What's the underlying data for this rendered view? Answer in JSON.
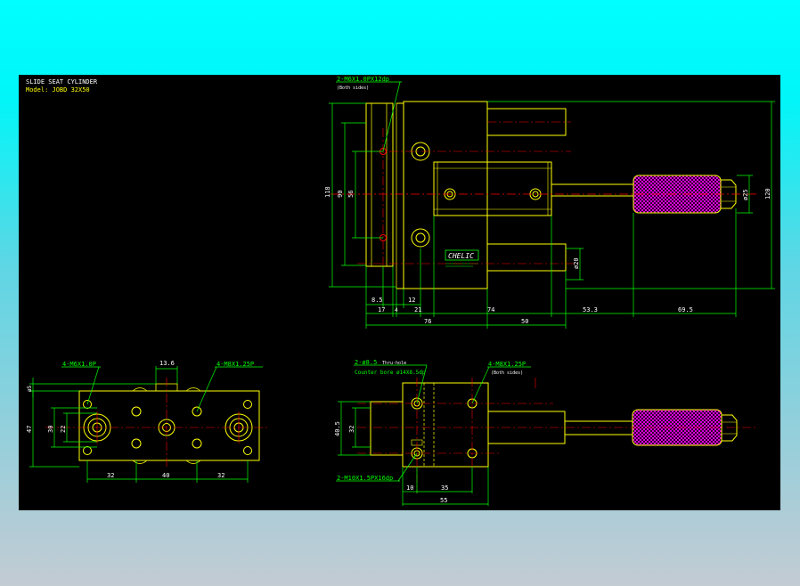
{
  "title_block": {
    "title": "SLIDE SEAT CYLINDER",
    "model": "Model: JOBD 32X50"
  },
  "brand": "CHELIC",
  "side_view": {
    "callout_port": "2-M6X1.0PX12dp",
    "callout_port_sub": "(Both sides)",
    "dims": {
      "height_118": "118",
      "height_90": "90",
      "height_56": "56",
      "dia_20": "ø20",
      "dia_25": "ø25",
      "height_120": "120",
      "d_8_5": "8.5",
      "d_12": "12",
      "d_17": "17",
      "d_4": "4",
      "d_21": "21",
      "d_74": "74",
      "d_53_3": "53.3",
      "d_69_5": "69.5",
      "d_76": "76",
      "d_50": "50"
    }
  },
  "bottom_view": {
    "callout_left": "4-M6X1.0P",
    "callout_right": "4-M8X1.25P",
    "dims": {
      "d_13_6": "13.6",
      "d_5": "ø5",
      "d_47": "47",
      "d_30": "30",
      "d_22": "22",
      "d_32a": "32",
      "d_40": "40",
      "d_32b": "32"
    }
  },
  "front_view": {
    "callout_hole": "2-ø8.5",
    "callout_hole_thru": "Thru-hole",
    "callout_cbore": "Counter bore  ø14X8.5dp",
    "callout_tap": "4-M8X1.25P",
    "callout_tap_sub": "(Both sides)",
    "callout_bottom": "2-M10X1.5PX16dp",
    "dims": {
      "d_40_5": "40.5",
      "d_32": "32",
      "d_10": "10",
      "d_35": "35",
      "d_55": "55"
    }
  },
  "colors": {
    "outline": "#ffff00",
    "dimension": "#00ff00",
    "center": "#ff0000",
    "hatch": "#ff00ff",
    "text": "#ffffff"
  }
}
